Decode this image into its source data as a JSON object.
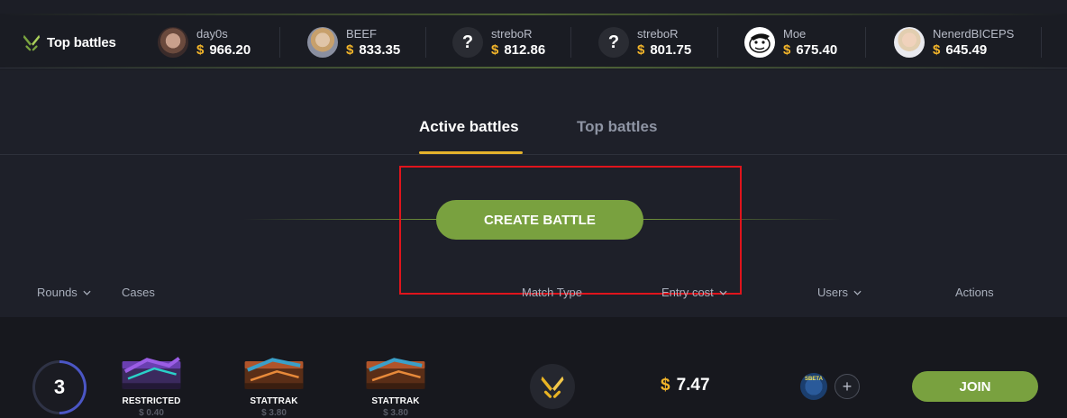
{
  "top_battles": {
    "title": "Top battles",
    "logo_icon": "swords-icon",
    "players": [
      {
        "name": "day0s",
        "currency": "$",
        "amount": "966.20",
        "avatar": "photo-avatar"
      },
      {
        "name": "BEEF",
        "currency": "$",
        "amount": "833.35",
        "avatar": "photo-avatar"
      },
      {
        "name": "streboR",
        "currency": "$",
        "amount": "812.86",
        "avatar": "unknown-avatar",
        "avatar_glyph": "?"
      },
      {
        "name": "streboR",
        "currency": "$",
        "amount": "801.75",
        "avatar": "unknown-avatar",
        "avatar_glyph": "?"
      },
      {
        "name": "Moe",
        "currency": "$",
        "amount": "675.40",
        "avatar": "cartoon-avatar"
      },
      {
        "name": "NenerdBICEPS",
        "currency": "$",
        "amount": "645.49",
        "avatar": "photo-avatar"
      }
    ]
  },
  "tabs": [
    {
      "label": "Active battles",
      "active": true
    },
    {
      "label": "Top battles",
      "active": false
    }
  ],
  "create_battle": {
    "label": "CREATE BATTLE"
  },
  "table": {
    "headers": {
      "rounds": "Rounds",
      "cases": "Cases",
      "match_type": "Match Type",
      "entry_cost": "Entry cost",
      "users": "Users",
      "actions": "Actions"
    }
  },
  "battle": {
    "rounds": "3",
    "cases": [
      {
        "label": "RESTRICTED",
        "price": "$ 0.40"
      },
      {
        "label": "STATTRAK",
        "price": "$ 3.80"
      },
      {
        "label": "STATTRAK",
        "price": "$ 3.80"
      }
    ],
    "match_type_icon": "swords-icon",
    "entry_currency": "$",
    "entry_cost": "7.47",
    "user_avatar_text": "SBETA",
    "add_user_glyph": "+",
    "join_label": "JOIN"
  },
  "colors": {
    "accent_green": "#79a13f",
    "gold": "#f3b52a",
    "rounds_ring": "#4b56c5",
    "highlight": "#e0141c"
  }
}
